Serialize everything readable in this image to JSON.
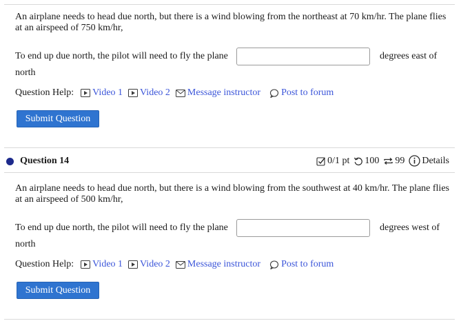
{
  "question13": {
    "prompt": "An airplane needs to head due north, but there is a wind blowing from the northeast at 70 km/hr. The plane flies at an airspeed of 750 km/hr,",
    "answer_lead": "To end up due north, the pilot will need to fly the plane",
    "answer_value": "",
    "answer_tail": "degrees east of",
    "answer_wrap": "north",
    "help_label": "Question Help:",
    "video1": "Video 1",
    "video2": "Video 2",
    "message": "Message instructor",
    "forum": "Post to forum",
    "submit_label": "Submit Question"
  },
  "question14": {
    "title": "Question 14",
    "score": "0/1 pt",
    "retries": "100",
    "attempts": "99",
    "details": "Details",
    "prompt": "An airplane needs to head due north, but there is a wind blowing from the southwest at 40 km/hr. The plane flies at an airspeed of 500 km/hr,",
    "answer_lead": "To end up due north, the pilot will need to fly the plane",
    "answer_value": "",
    "answer_tail": "degrees west of",
    "answer_wrap": "north",
    "help_label": "Question Help:",
    "video1": "Video 1",
    "video2": "Video 2",
    "message": "Message instructor",
    "forum": "Post to forum",
    "submit_label": "Submit Question"
  },
  "colors": {
    "link": "#3b55d9",
    "button": "#2f74d0",
    "status_dot": "#1d2a8c"
  },
  "icons": [
    "video-icon",
    "message-icon",
    "forum-icon",
    "score-check-icon",
    "retry-icon",
    "attempts-icon",
    "info-icon"
  ]
}
